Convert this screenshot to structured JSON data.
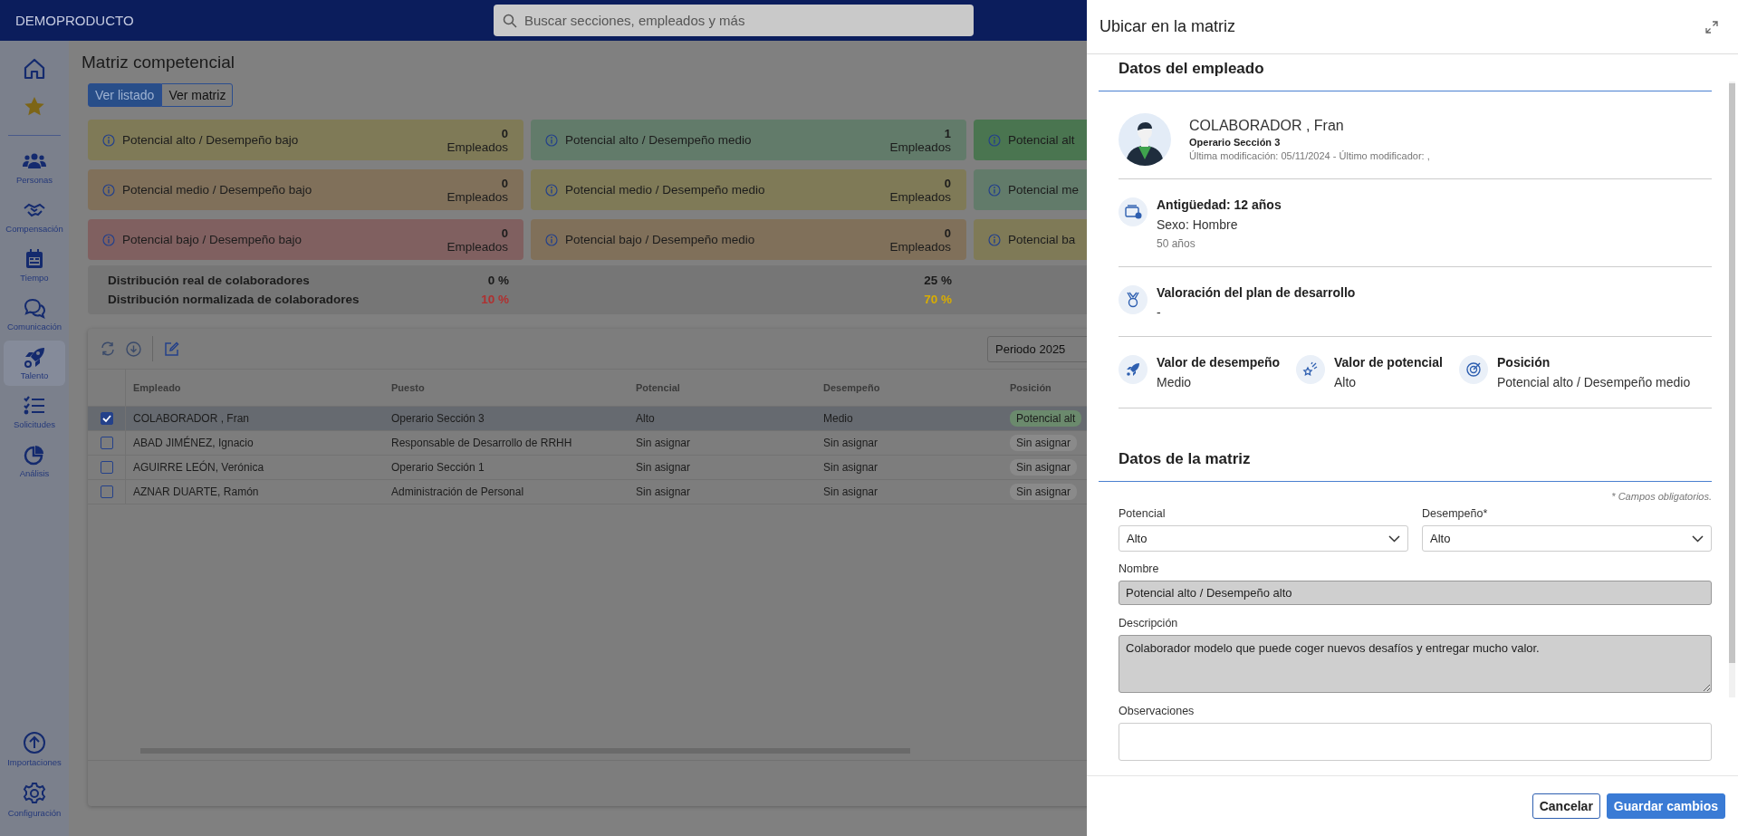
{
  "header": {
    "brand": "DEMOPRODUCTO",
    "search": {
      "placeholder": "Buscar secciones, empleados y más"
    }
  },
  "sidebar": {
    "items": [
      {
        "label": "Personas",
        "selected": false
      },
      {
        "label": "Compensación",
        "selected": false
      },
      {
        "label": "Tiempo",
        "selected": false
      },
      {
        "label": "Comunicación",
        "selected": false
      },
      {
        "label": "Talento",
        "selected": true
      },
      {
        "label": "Solicitudes",
        "selected": false
      },
      {
        "label": "Análisis",
        "selected": false
      }
    ],
    "bottom_items": [
      {
        "label": "Importaciones"
      },
      {
        "label": "Configuración"
      }
    ]
  },
  "page": {
    "title": "Matriz competencial",
    "view_toggle": [
      {
        "label": "Ver listado",
        "selected": true
      },
      {
        "label": "Ver matriz",
        "selected": false
      }
    ],
    "cards": [
      {
        "title": "Potencial alto / Desempeño bajo",
        "count": "0",
        "unit": "Empleados",
        "color": "#7f7a57"
      },
      {
        "title": "Potencial alto / Desempeño medio",
        "count": "1",
        "unit": "Empleados",
        "color": "#627b6a"
      },
      {
        "title": "Potencial alt",
        "color": "#4a7550"
      },
      {
        "title": "Potencial medio / Desempeño bajo",
        "count": "0",
        "unit": "Empleados",
        "color": "#80705a"
      },
      {
        "title": "Potencial medio / Desempeño medio",
        "count": "0",
        "unit": "Empleados",
        "color": "#7f7a57"
      },
      {
        "title": "Potencial me",
        "color": "#627b6a"
      },
      {
        "title": "Potencial bajo / Desempeño bajo",
        "count": "0",
        "unit": "Empleados",
        "color": "#806060"
      },
      {
        "title": "Potencial bajo / Desempeño medio",
        "count": "0",
        "unit": "Empleados",
        "color": "#80705a"
      },
      {
        "title": "Potencial ba",
        "color": "#7f7a57"
      }
    ],
    "distribution": [
      {
        "label": "Distribución real de colaboradores",
        "values": [
          {
            "text": "0 %",
            "color": "#1a1a1a"
          },
          {
            "text": "25 %",
            "color": "#1a1a1a"
          }
        ]
      },
      {
        "label": "Distribución normalizada de colaboradores",
        "values": [
          {
            "text": "10 %",
            "color": "#b03030"
          },
          {
            "text": "70 %",
            "color": "#d9ad00"
          }
        ]
      }
    ],
    "table": {
      "period": {
        "value": "Periodo 2025"
      },
      "columns": [
        "Empleado",
        "Puesto",
        "Potencial",
        "Desempeño",
        "Posición"
      ],
      "rows": [
        {
          "checked": true,
          "selected": true,
          "cells": [
            "COLABORADOR , Fran",
            "Operario Sección 3",
            "Alto",
            "Medio"
          ],
          "position": {
            "text": "Potencial alt",
            "color": "#6b8a6d"
          }
        },
        {
          "checked": false,
          "selected": false,
          "cells": [
            "ABAD JIMÉNEZ, Ignacio",
            "Responsable de Desarrollo de RRHH",
            "Sin asignar",
            "Sin asignar"
          ],
          "position": {
            "text": "Sin asignar",
            "color": "#8a8a8a"
          }
        },
        {
          "checked": false,
          "selected": false,
          "cells": [
            "AGUIRRE LEÓN, Verónica",
            "Operario Sección 1",
            "Sin asignar",
            "Sin asignar"
          ],
          "position": {
            "text": "Sin asignar",
            "color": "#8a8a8a"
          }
        },
        {
          "checked": false,
          "selected": false,
          "cells": [
            "AZNAR DUARTE, Ramón",
            "Administración de Personal",
            "Sin asignar",
            "Sin asignar"
          ],
          "position": {
            "text": "Sin asignar",
            "color": "#8a8a8a"
          }
        }
      ]
    }
  },
  "drawer": {
    "title": "Ubicar en la matriz",
    "employee_section": {
      "title": "Datos del empleado",
      "name": "COLABORADOR , Fran",
      "job": "Operario Sección 3",
      "modified": "Última modificación: 05/11/2024 - Último modificador: ,",
      "seniority": {
        "title": "Antigüedad: 12 años",
        "sex": "Sexo: Hombre",
        "age": "50 años"
      },
      "plan": {
        "title": "Valoración del plan de desarrollo",
        "value": "-"
      },
      "values": [
        {
          "title": "Valor de desempeño",
          "value": "Medio"
        },
        {
          "title": "Valor de potencial",
          "value": "Alto"
        },
        {
          "title": "Posición",
          "value": "Potencial alto / Desempeño medio"
        }
      ]
    },
    "matrix_section": {
      "title": "Datos de la matriz",
      "required_note": "* Campos obligatorios.",
      "selects": [
        {
          "label": "Potencial",
          "value": "Alto"
        },
        {
          "label": "Desempeño*",
          "value": "Alto"
        }
      ],
      "name_field": {
        "label": "Nombre",
        "value": "Potencial alto / Desempeño alto",
        "disabled": true
      },
      "description_field": {
        "label": "Descripción",
        "value": "Colaborador modelo que puede coger nuevos desafíos y entregar mucho valor.",
        "disabled": true
      },
      "observations_field": {
        "label": "Observaciones"
      }
    },
    "buttons": [
      {
        "label": "Cancelar",
        "kind": "secondary"
      },
      {
        "label": "Guardar cambios",
        "kind": "primary"
      }
    ]
  }
}
